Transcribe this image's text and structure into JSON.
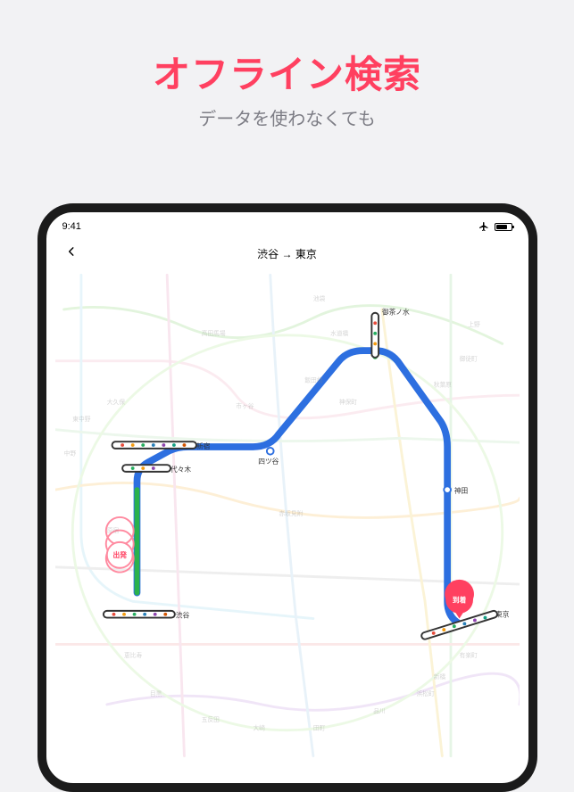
{
  "promo": {
    "title": "オフライン検索",
    "subtitle": "データを使わなくても"
  },
  "device": {
    "time": "9:41",
    "route_header": "渋谷 → 東京"
  },
  "pins": {
    "depart_label": "出発",
    "arrive_label": "到着"
  },
  "stations": {
    "shibuya": "渋谷",
    "yoyogi": "代々木",
    "shinjuku": "新宿",
    "yotsuya": "四ツ谷",
    "ochanomizu": "御茶ノ水",
    "kanda": "神田",
    "tokyo": "東京"
  },
  "bg_labels": [
    "高田馬場",
    "東中野",
    "中野",
    "大久保",
    "市ヶ谷",
    "飯田橋",
    "水道橋",
    "秋葉原",
    "上野",
    "日暮里",
    "池袋",
    "原宿",
    "恵比寿",
    "目黒",
    "五反田",
    "品川",
    "新橋",
    "有楽町",
    "浜松町",
    "田町",
    "大崎",
    "御徒町",
    "神保町",
    "赤坂見附"
  ],
  "colors": {
    "accent": "#ff4060",
    "route": "#2d6fe0",
    "green": "#2bb24c"
  }
}
